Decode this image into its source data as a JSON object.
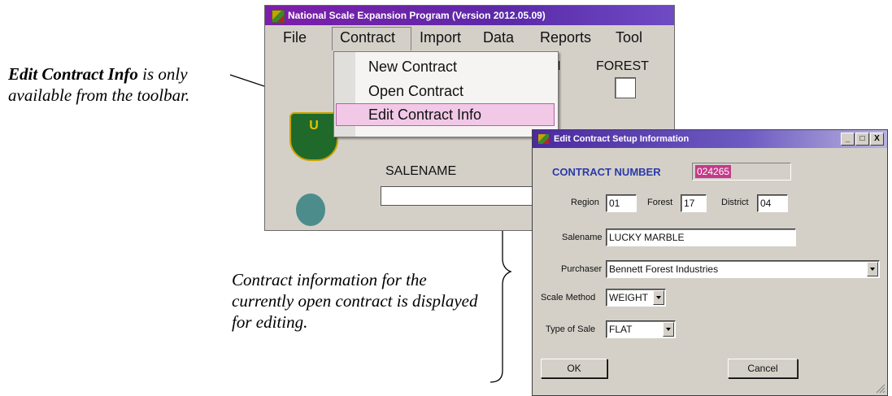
{
  "captions": {
    "edit_info_bold": "Edit Contract Info",
    "edit_info_rest": " is only available from the toolbar.",
    "contract_info": "Contract information for the currently open contract is displayed for editing."
  },
  "main_window": {
    "title": "National Scale Expansion Program (Version 2012.05.09)",
    "menu": [
      "File",
      "Contract",
      "Import",
      "Data",
      "Reports",
      "Tool"
    ],
    "n_label": "N",
    "forest_label": "FOREST",
    "salename_label": "SALENAME",
    "logo_text": "U"
  },
  "dropdown": {
    "items": [
      "New Contract",
      "Open Contract",
      "Edit Contract Info"
    ],
    "highlighted": "Edit Contract Info"
  },
  "dialog": {
    "title": "Edit Contract Setup Information",
    "window_buttons": [
      "_",
      "□",
      "X"
    ],
    "contract_number_label": "CONTRACT NUMBER",
    "contract_number": "024265",
    "region_label": "Region",
    "region": "01",
    "forest_label": "Forest",
    "forest": "17",
    "district_label": "District",
    "district": "04",
    "salename_label": "Salename",
    "salename": "LUCKY MARBLE",
    "purchaser_label": "Purchaser",
    "purchaser": "Bennett Forest Industries",
    "scale_method_label": "Scale Method",
    "scale_method": "WEIGHT",
    "type_of_sale_label": "Type of Sale",
    "type_of_sale": "FLAT",
    "ok_label": "OK",
    "cancel_label": "Cancel"
  },
  "colors": {
    "title_bar": "#5b2aa8",
    "highlight": "#f1c8e6",
    "contract_number_highlight": "#c43a8a",
    "contract_number_label": "#2b3aa8"
  }
}
